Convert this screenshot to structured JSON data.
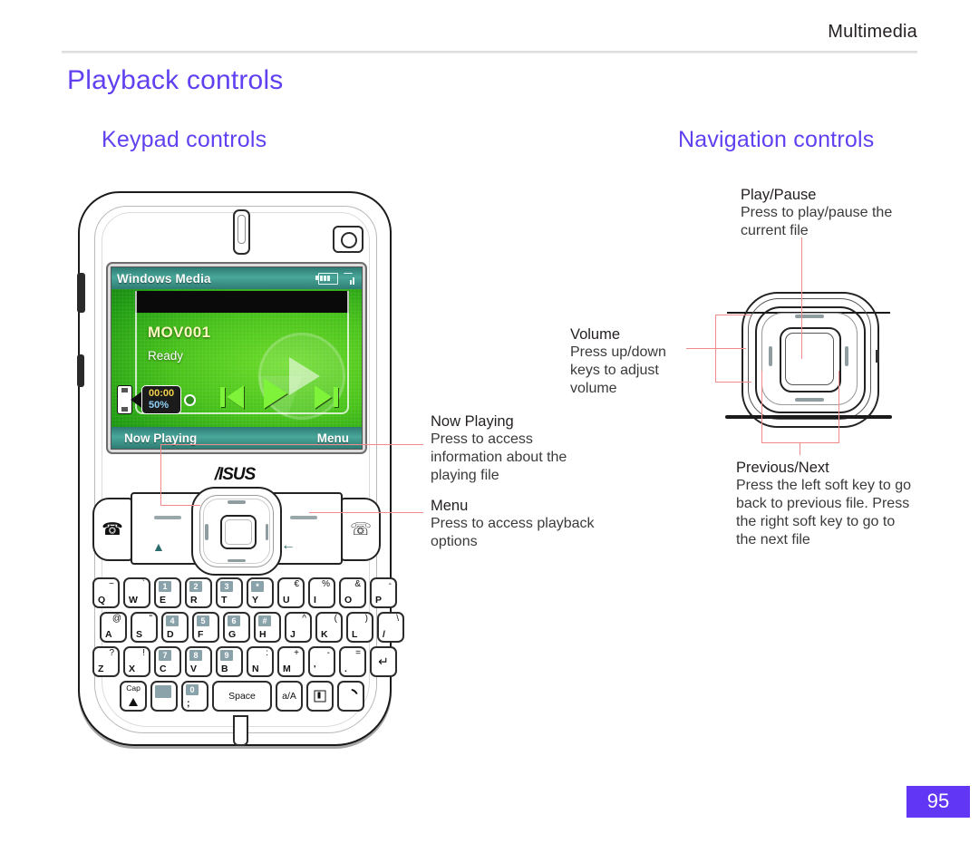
{
  "header": {
    "section": "Multimedia",
    "page_number": "95"
  },
  "headings": {
    "title": "Playback controls",
    "left_subtitle": "Keypad controls",
    "right_subtitle": "Navigation controls"
  },
  "colors": {
    "heading": "#6040F0",
    "page_badge": "#6236F5",
    "connector": "#F28C8C"
  },
  "phone_screen": {
    "status_bar": {
      "title": "Windows Media",
      "battery_icon": "battery-icon",
      "signal_icon": "signal-icon"
    },
    "media": {
      "file_name": "MOV001",
      "status": "Ready"
    },
    "volume_osd": {
      "time": "00:00",
      "level": "50%",
      "speaker_icon": "speaker-icon"
    },
    "transport": {
      "previous": "previous-icon",
      "play": "play-icon",
      "next": "next-icon"
    },
    "soft_keys": {
      "left": "Now Playing",
      "right": "Menu"
    }
  },
  "phone_body": {
    "brand": "/ISUS",
    "call_button": "call-icon",
    "end_button": "end-call-icon",
    "home_icon": "home-icon",
    "back_icon": "back-icon"
  },
  "keyboard": {
    "rows": [
      [
        {
          "low": "Q",
          "up": "~"
        },
        {
          "low": "W",
          "up": "`"
        },
        {
          "low": "E",
          "num": "1"
        },
        {
          "low": "R",
          "num": "2"
        },
        {
          "low": "T",
          "num": "3"
        },
        {
          "low": "Y",
          "num": "*"
        },
        {
          "low": "U",
          "up": "€"
        },
        {
          "low": "I",
          "up": "%"
        },
        {
          "low": "O",
          "up": "&"
        },
        {
          "low": "P",
          "up": "-"
        }
      ],
      [
        {
          "low": "A",
          "up": "@"
        },
        {
          "low": "S",
          "up": "\""
        },
        {
          "low": "D",
          "num": "4"
        },
        {
          "low": "F",
          "num": "5"
        },
        {
          "low": "G",
          "num": "6"
        },
        {
          "low": "H",
          "num": "#"
        },
        {
          "low": "J",
          "up": "^"
        },
        {
          "low": "K",
          "up": "("
        },
        {
          "low": "L",
          "up": ")"
        },
        {
          "low": "/",
          "up": "\\"
        }
      ],
      [
        {
          "low": "Z",
          "up": "?"
        },
        {
          "low": "X",
          "up": "!"
        },
        {
          "low": "C",
          "num": "7"
        },
        {
          "low": "V",
          "num": "8"
        },
        {
          "low": "B",
          "num": "9"
        },
        {
          "low": "N",
          "up": ":"
        },
        {
          "low": "M",
          "up": "+"
        },
        {
          "low": "'",
          "up": "-"
        },
        {
          "low": ".",
          "up": "="
        },
        {
          "low": "",
          "up": "",
          "enter": true
        }
      ]
    ],
    "bottom_row": {
      "cap_label": "Cap",
      "blank_key": "",
      "zero_key": {
        "num": "0",
        "low": ";"
      },
      "space_label": "Space",
      "case_label": "a/A",
      "symbol_key": "symbol-icon",
      "power_key": "power-icon"
    }
  },
  "annotations": [
    {
      "id": "now-playing",
      "title": "Now Playing",
      "lines": [
        "Press to access",
        "information about the",
        "playing file"
      ]
    },
    {
      "id": "menu",
      "title": "Menu",
      "lines": [
        "Press to access playback",
        "options"
      ]
    },
    {
      "id": "play-pause",
      "title": "Play/Pause",
      "lines": [
        "Press to play/pause the",
        "current file"
      ]
    },
    {
      "id": "volume",
      "title": "Volume",
      "lines": [
        "Press up/down",
        "keys to adjust",
        "volume"
      ]
    },
    {
      "id": "previous-next",
      "title": "Previous/Next",
      "lines": [
        "Press the left soft key to go",
        "back to previous file. Press",
        "the right soft key to go to",
        "the next file"
      ]
    }
  ]
}
